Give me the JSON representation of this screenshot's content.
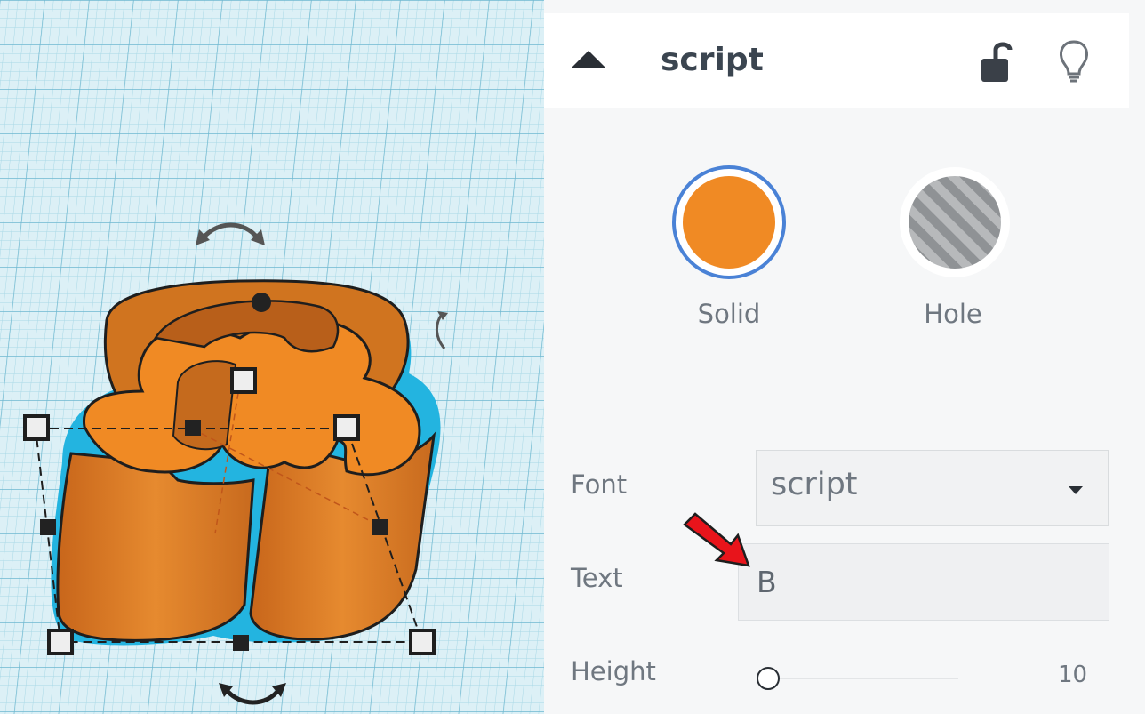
{
  "panel": {
    "shape_name": "script",
    "solid_label": "Solid",
    "hole_label": "Hole",
    "font_label": "Font",
    "font_value": "script",
    "text_label": "Text",
    "text_value": "B",
    "height_label": "Height",
    "height_value": "10"
  },
  "colors": {
    "shape_fill": "#f08a24",
    "selection_outline": "#1aa8d6",
    "annotation_arrow": "#e8141b",
    "grid_background": "#dcf0f6"
  },
  "icons": [
    "caret-up-icon",
    "unlock-icon",
    "lightbulb-icon",
    "rotate-arrow-icon",
    "dropdown-caret-icon",
    "annotation-arrow-icon"
  ]
}
